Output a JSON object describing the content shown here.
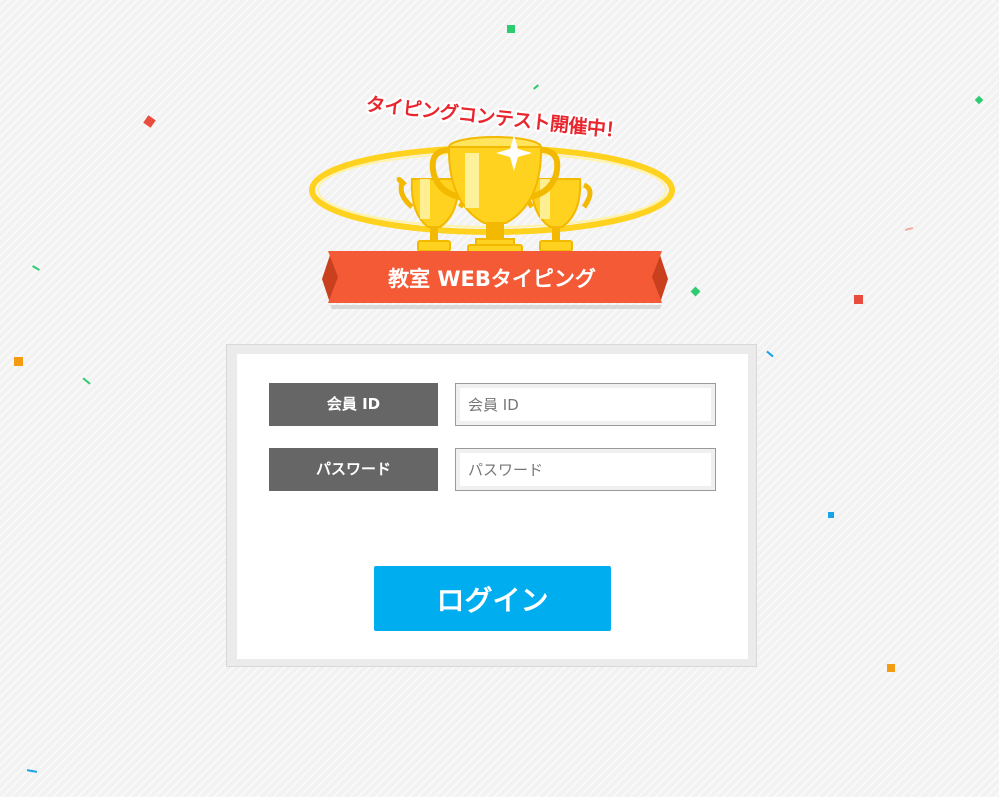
{
  "logo": {
    "contest_text": "タイピングコンテスト開催中！",
    "title": "教室 WEBタイピング"
  },
  "form": {
    "member_id_label": "会員 ID",
    "member_id_placeholder": "会員 ID",
    "member_id_value": "",
    "password_label": "パスワード",
    "password_placeholder": "パスワード",
    "password_value": ""
  },
  "login_button_label": "ログイン",
  "colors": {
    "ribbon": "#f45a36",
    "trophy": "#ffd21f",
    "label_bg": "#666666",
    "button": "#00aeef"
  }
}
